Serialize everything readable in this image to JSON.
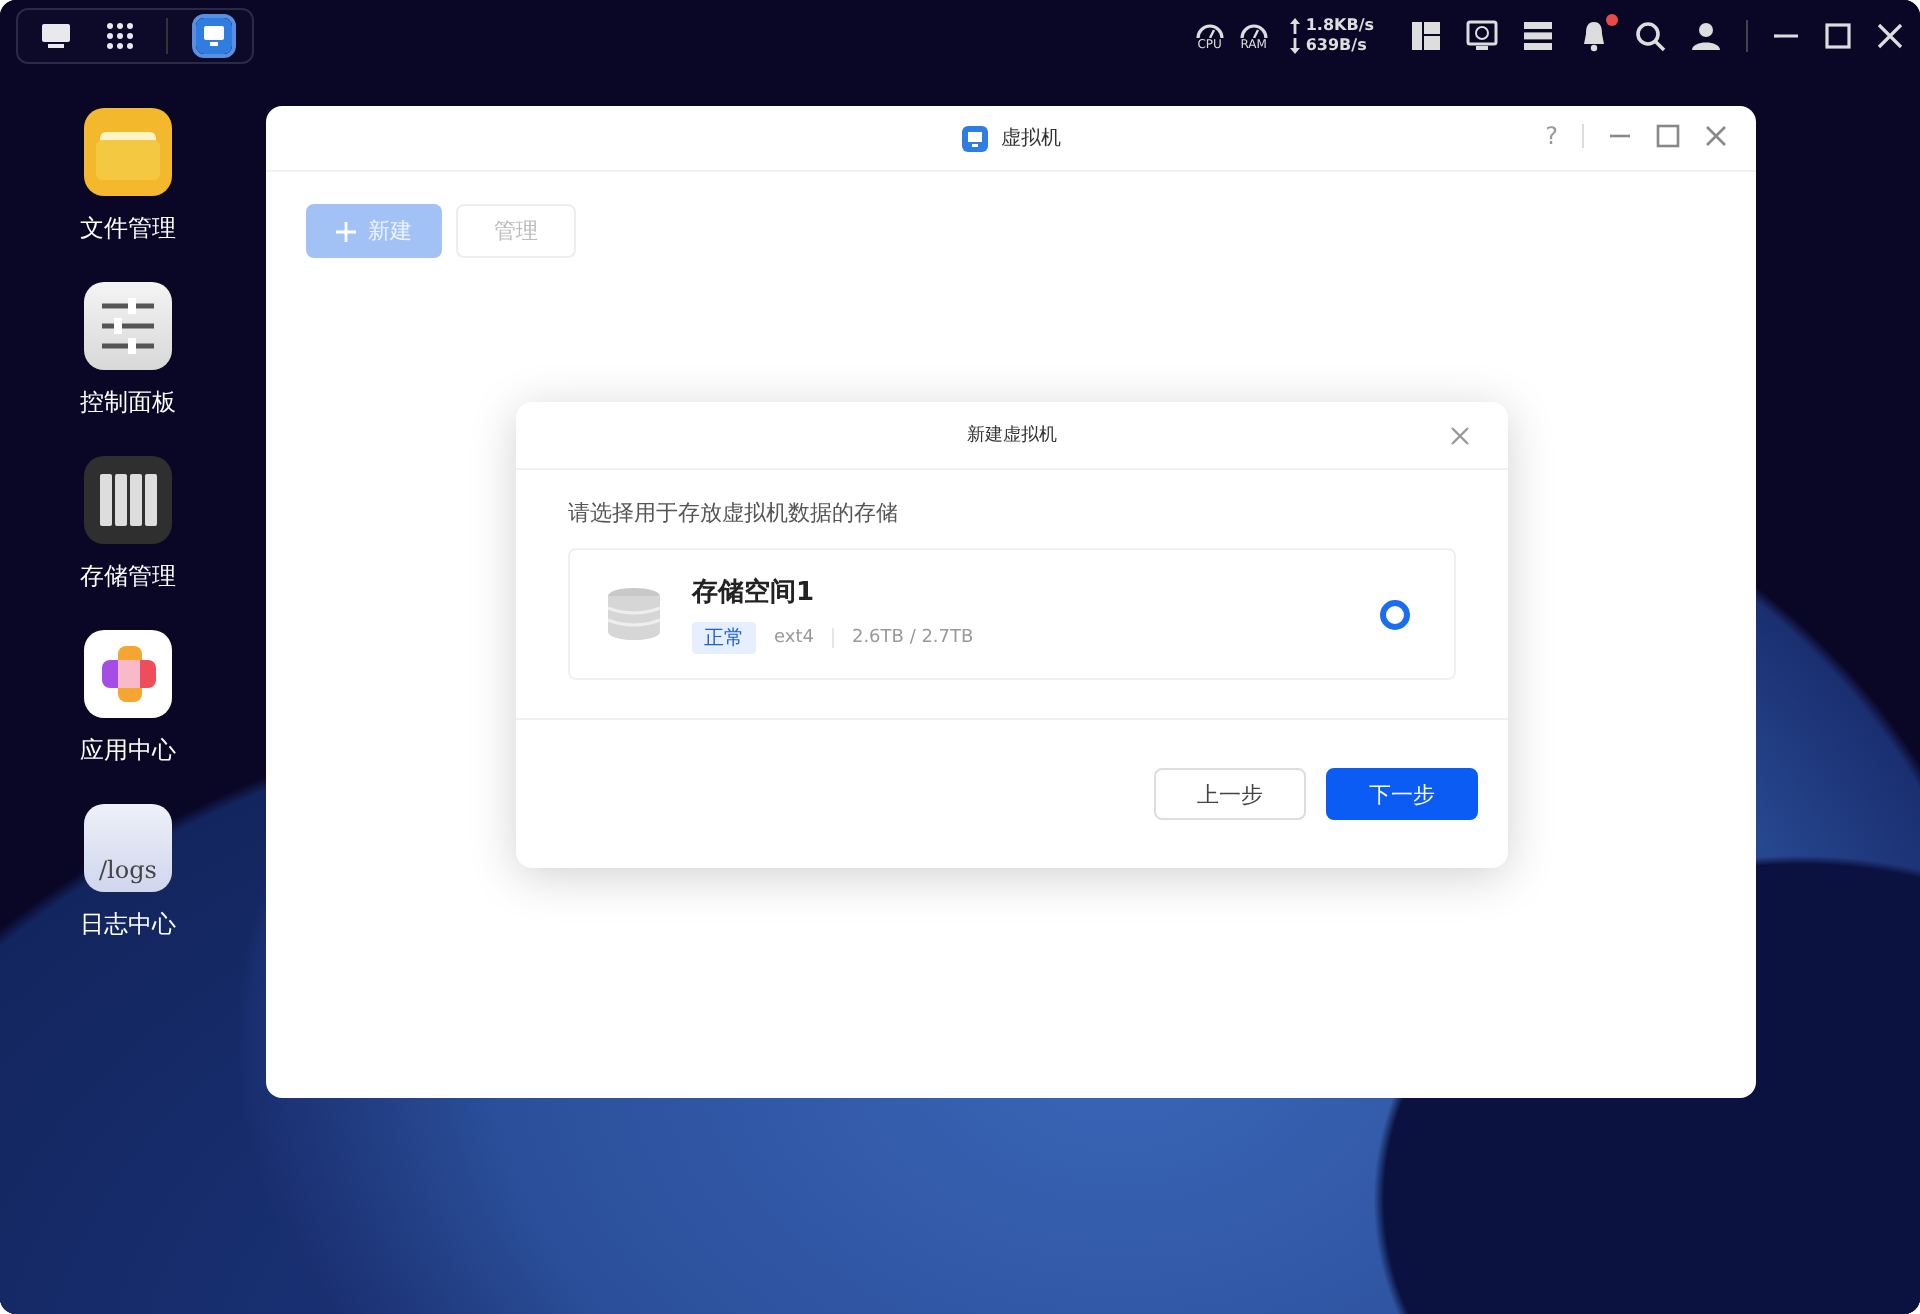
{
  "taskbar": {
    "buttons": [
      {
        "kind": "desktop",
        "selected": false
      },
      {
        "kind": "launcher",
        "selected": false
      },
      {
        "kind": "vm",
        "selected": true
      }
    ]
  },
  "status": {
    "cpu_label": "CPU",
    "ram_label": "RAM",
    "upload": "1.8KB/s",
    "download": "639B/s",
    "bell_alert": true
  },
  "desktop_icons": [
    {
      "kind": "files",
      "label": "文件管理"
    },
    {
      "kind": "control",
      "label": "控制面板"
    },
    {
      "kind": "storage",
      "label": "存储管理"
    },
    {
      "kind": "apps",
      "label": "应用中心"
    },
    {
      "kind": "logs",
      "label": "日志中心",
      "icon_text": "/logs"
    }
  ],
  "window": {
    "title": "虚拟机",
    "help": "?",
    "toolbar": [
      {
        "kind": "primary",
        "label": "新建",
        "disabled": true
      },
      {
        "kind": "default",
        "label": "管理",
        "disabled": true
      }
    ]
  },
  "dialog": {
    "title": "新建虚拟机",
    "prompt": "请选择用于存放虚拟机数据的存储",
    "storage_options": [
      {
        "name": "存储空间1",
        "status": "正常",
        "filesystem": "ext4",
        "usage": "2.6TB / 2.7TB",
        "selected": true
      }
    ],
    "buttons": [
      {
        "kind": "secondary",
        "label": "上一步"
      },
      {
        "kind": "primary",
        "label": "下一步"
      }
    ]
  }
}
